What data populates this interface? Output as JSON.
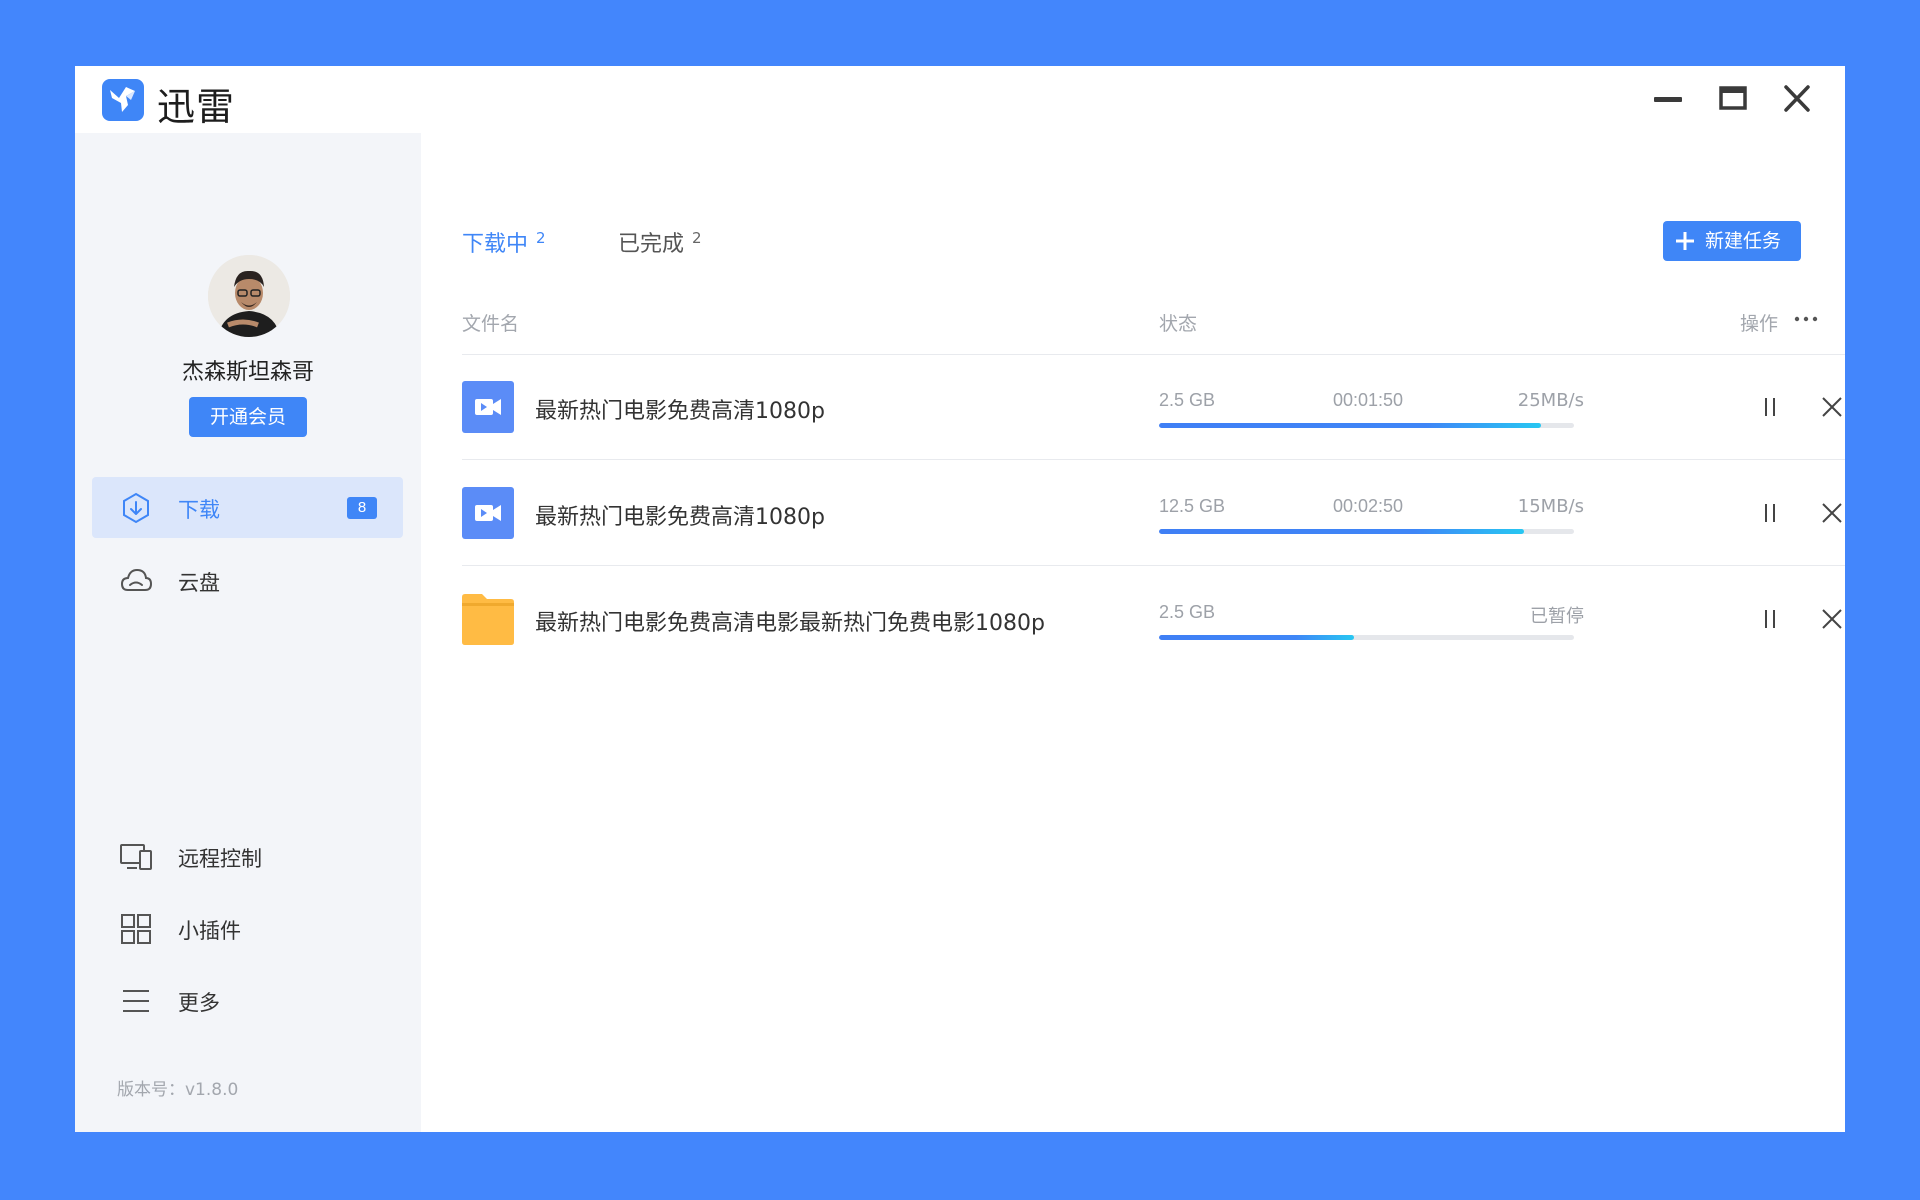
{
  "app": {
    "title": "迅雷",
    "icon": "thunder-bird-logo-icon",
    "window_controls": [
      "minimize-icon",
      "maximize-icon",
      "close-icon"
    ]
  },
  "colors": {
    "background": "#4386fc",
    "accent": "#3f86f7",
    "sidebar_bg": "#f3f5f9",
    "active_nav_bg": "#dbe6fb",
    "video_icon": "#5b8cf7",
    "folder_icon": "#ffbb44"
  },
  "user": {
    "name": "杰森斯坦森哥",
    "vip_button": "开通会员"
  },
  "sidebar": {
    "top_items": [
      {
        "label": "下载",
        "icon": "download-icon",
        "badge": "8",
        "active": true
      },
      {
        "label": "云盘",
        "icon": "cloud-icon",
        "active": false
      }
    ],
    "bottom_items": [
      {
        "label": "远程控制",
        "icon": "remote-devices-icon"
      },
      {
        "label": "小插件",
        "icon": "grid-icon"
      },
      {
        "label": "更多",
        "icon": "menu-icon"
      }
    ],
    "version": "版本号：v1.8.0"
  },
  "tabs": [
    {
      "label": "下载中",
      "count": "2",
      "active": true
    },
    {
      "label": "已完成",
      "count": "2",
      "active": false
    }
  ],
  "new_task": {
    "label": "新建任务",
    "icon": "plus-icon"
  },
  "table": {
    "headers": {
      "name": "文件名",
      "status": "状态",
      "actions": "操作",
      "more_icon": "more-dots-icon"
    },
    "rows": [
      {
        "icon": "video-icon",
        "name": "最新热门电影免费高清1080p",
        "size": "2.5 GB",
        "time": "00:01:50",
        "right": "25MB/s",
        "progress": 0.92
      },
      {
        "icon": "video-icon",
        "name": "最新热门电影免费高清1080p",
        "size": "12.5 GB",
        "time": "00:02:50",
        "right": "15MB/s",
        "progress": 0.88
      },
      {
        "icon": "folder-icon",
        "name": "最新热门电影免费高清电影最新热门免费电影1080p",
        "size": "2.5 GB",
        "time": "",
        "right": "已暂停",
        "progress": 0.47
      }
    ]
  }
}
